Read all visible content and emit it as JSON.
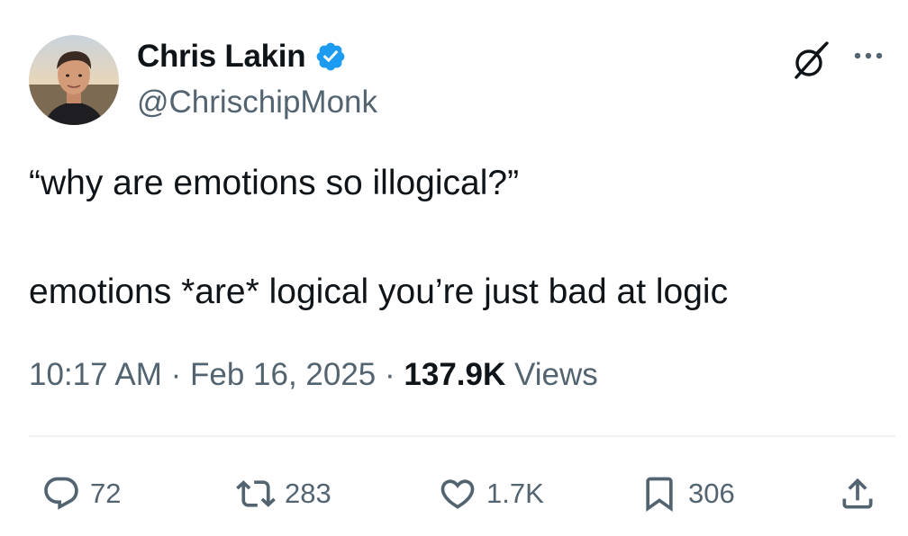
{
  "author": {
    "name": "Chris Lakin",
    "handle": "@ChrischipMonk",
    "verified": true
  },
  "tweet": {
    "line1": "“why are emotions so illogical?”",
    "line2": "emotions *are* logical you’re just bad at logic"
  },
  "meta": {
    "time": "10:17 AM",
    "sep1": " · ",
    "date": "Feb 16, 2025",
    "sep2": " · ",
    "views_count": "137.9K",
    "views_label": " Views"
  },
  "actions": {
    "replies": "72",
    "retweets": "283",
    "likes": "1.7K",
    "bookmarks": "306"
  },
  "colors": {
    "text": "#0f1419",
    "secondary": "#536471",
    "verified": "#1d9bf0",
    "divider": "#eff3f4"
  },
  "icons": {
    "verified": "verified-badge-icon",
    "grok": "grok-icon",
    "more": "more-dots-icon",
    "reply": "reply-bubble-icon",
    "retweet": "retweet-icon",
    "like": "heart-icon",
    "bookmark": "bookmark-icon",
    "share": "share-icon"
  }
}
